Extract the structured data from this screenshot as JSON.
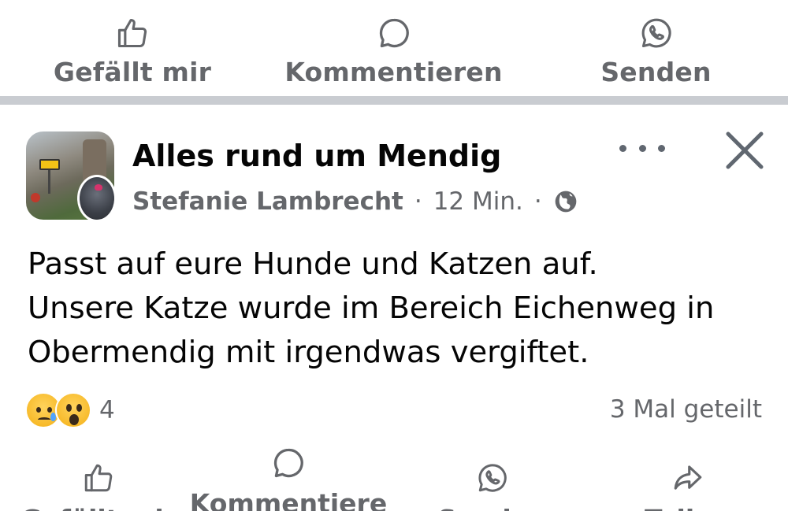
{
  "top_actions": {
    "like_label": "Gefällt mir",
    "comment_label": "Kommentieren",
    "send_label": "Senden"
  },
  "post": {
    "group_name": "Alles rund um Mendig",
    "author": "Stefanie Lambrecht",
    "time": "12 Min.",
    "separator": "·",
    "privacy_icon": "globe-icon",
    "text_lines": [
      "Passt auf eure Hunde und Katzen auf.",
      "Unsere Katze wurde im Bereich Eichenweg in",
      "Obermendig mit irgendwas vergiftet."
    ],
    "reactions": {
      "icons": [
        "sad-reaction-icon",
        "wow-reaction-icon"
      ],
      "count": "4"
    },
    "shares": "3 Mal geteilt"
  },
  "bottom_actions": {
    "like_label": "Gefällt mir",
    "comment_label": "Kommentiere",
    "send_label": "Senden",
    "share_label": "Teilen"
  },
  "colors": {
    "secondary_text": "#65676b",
    "primary_text": "#050505",
    "separator": "#c9ccd1",
    "reaction_yellow": "#f7b928"
  }
}
